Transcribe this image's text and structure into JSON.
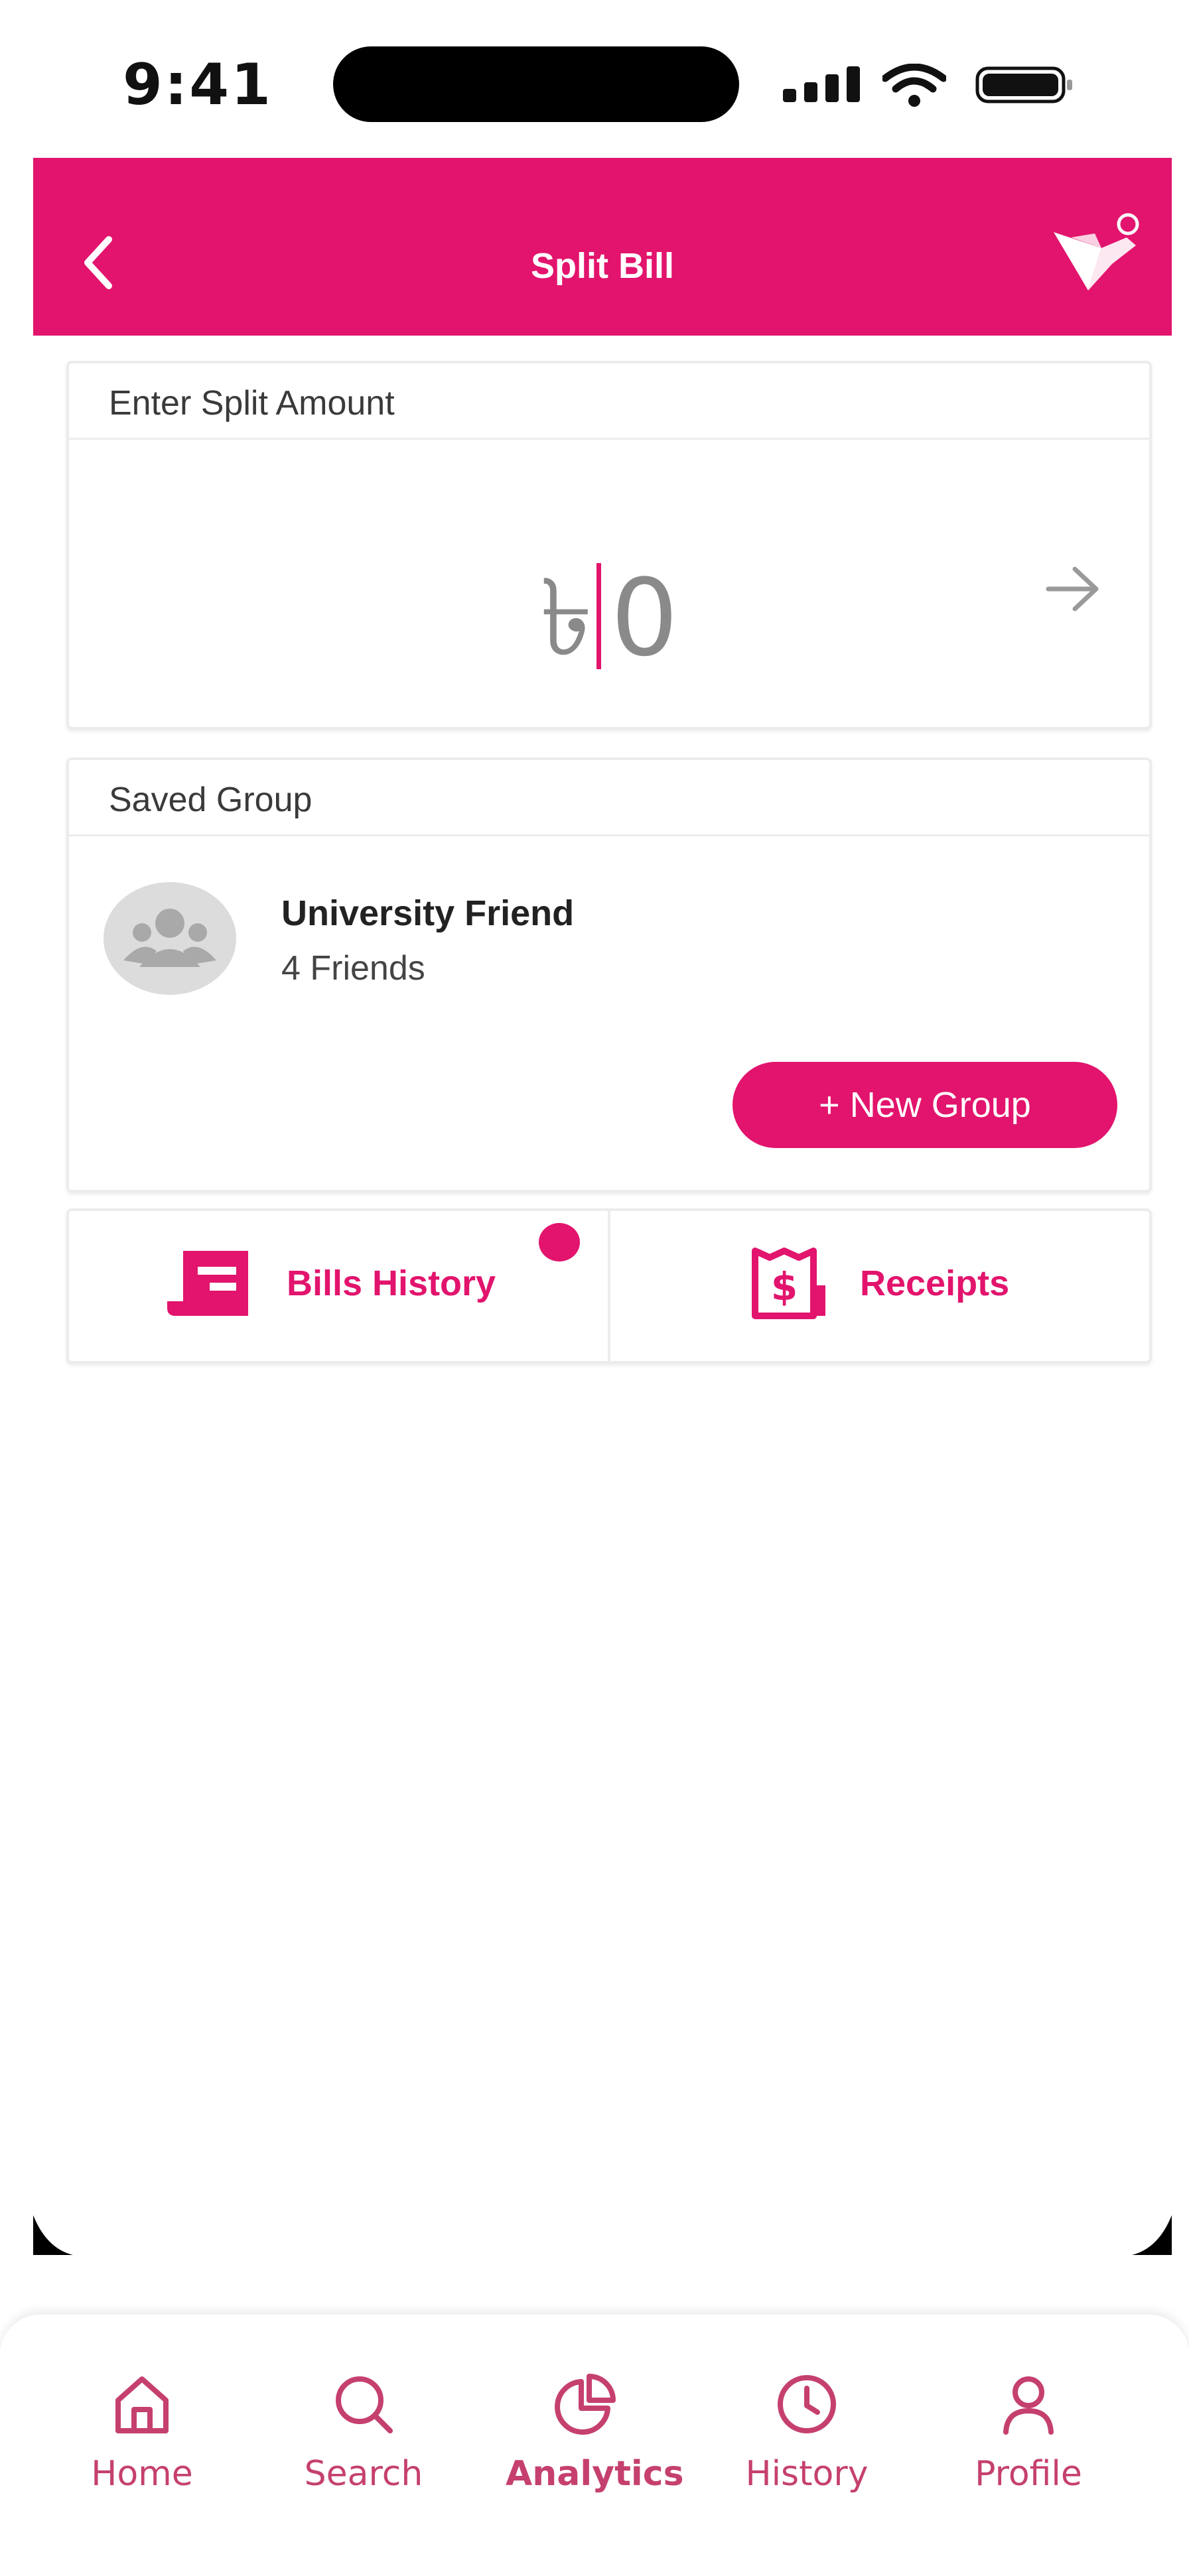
{
  "status": {
    "time": "9:41"
  },
  "header": {
    "title": "Split Bill"
  },
  "amount_card": {
    "title": "Enter Split Amount",
    "currency": "৳",
    "value": "0"
  },
  "saved_group": {
    "title": "Saved Group",
    "group_name": "University Friend",
    "group_members": "4 Friends",
    "new_group_label": "+   New Group"
  },
  "tiles": {
    "bills_history": "Bills History",
    "receipts": "Receipts"
  },
  "tabs": [
    {
      "label": "Home",
      "icon": "home-icon"
    },
    {
      "label": "Search",
      "icon": "search-icon"
    },
    {
      "label": "Analytics",
      "icon": "pie-chart-icon"
    },
    {
      "label": "History",
      "icon": "clock-icon"
    },
    {
      "label": "Profile",
      "icon": "user-icon"
    }
  ],
  "colors": {
    "brand": "#e2146d",
    "tab": "#c5406f"
  }
}
